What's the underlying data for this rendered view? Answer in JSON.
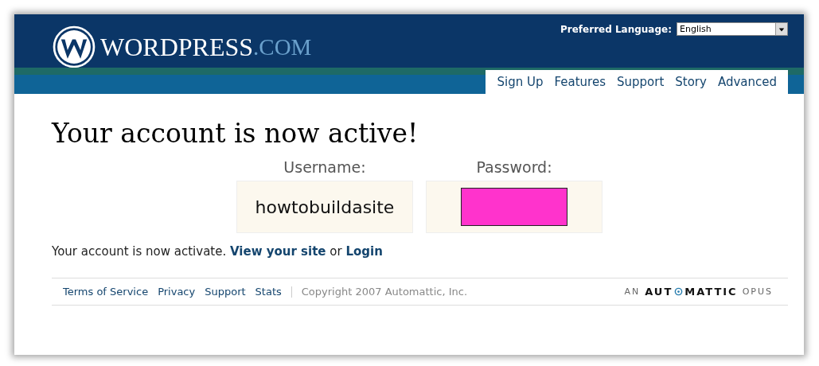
{
  "header": {
    "logo_word": "WORDPRESS",
    "logo_suffix": ".COM",
    "language_label": "Preferred Language:",
    "language": {
      "value": "English"
    }
  },
  "nav": [
    {
      "label": "Sign Up"
    },
    {
      "label": "Features"
    },
    {
      "label": "Support"
    },
    {
      "label": "Story"
    },
    {
      "label": "Advanced"
    }
  ],
  "title": "Your account is now active!",
  "credentials": [
    {
      "label": "Username:",
      "value": "howtobuildasite",
      "redacted": false
    },
    {
      "label": "Password:",
      "redacted": true
    }
  ],
  "message": "Your account is now activate. **View your site** or **Login**",
  "footer": {
    "links": [
      {
        "label": "Terms of Service"
      },
      {
        "label": "Privacy"
      },
      {
        "label": "Support"
      },
      {
        "label": "Stats"
      }
    ],
    "copyright": "Copyright 2007 Automattic, Inc.",
    "brand": {
      "prefix": "AN",
      "start": "AUT",
      "end": "MATTIC",
      "suffix": "OPUS"
    }
  }
}
